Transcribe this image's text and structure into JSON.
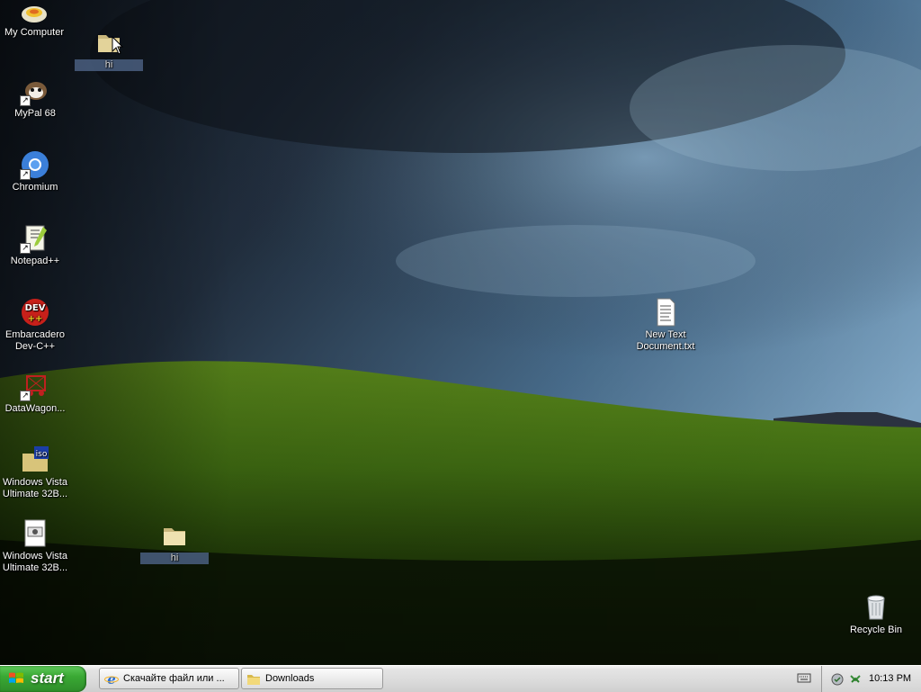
{
  "desktop_icons": [
    {
      "id": "my-computer",
      "label": "My Computer"
    },
    {
      "id": "hi-folder-top",
      "label": "hi"
    },
    {
      "id": "mypal",
      "label": "MyPal 68"
    },
    {
      "id": "chromium",
      "label": "Chromium"
    },
    {
      "id": "notepadpp",
      "label": "Notepad++"
    },
    {
      "id": "devcpp",
      "label": "Embarcadero Dev-C++"
    },
    {
      "id": "datawagon",
      "label": "DataWagon..."
    },
    {
      "id": "vista-iso",
      "label": "Windows Vista Ultimate 32B..."
    },
    {
      "id": "vista-img",
      "label": "Windows Vista Ultimate 32B..."
    },
    {
      "id": "hi-folder-bottom",
      "label": "hi"
    },
    {
      "id": "new-text-document",
      "label": "New Text Document.txt"
    },
    {
      "id": "recycle-bin",
      "label": "Recycle Bin"
    }
  ],
  "taskbar": {
    "start_label": "start",
    "tasks": [
      {
        "label": "Скачайте файл или ...",
        "icon": "internet-explorer-icon"
      },
      {
        "label": "Downloads",
        "icon": "folder-icon"
      }
    ],
    "clock": "10:13 PM"
  },
  "colors": {
    "start_green": "#3aa934",
    "selection_blue": "#4a5f80",
    "taskbar_gray": "#dadada"
  }
}
